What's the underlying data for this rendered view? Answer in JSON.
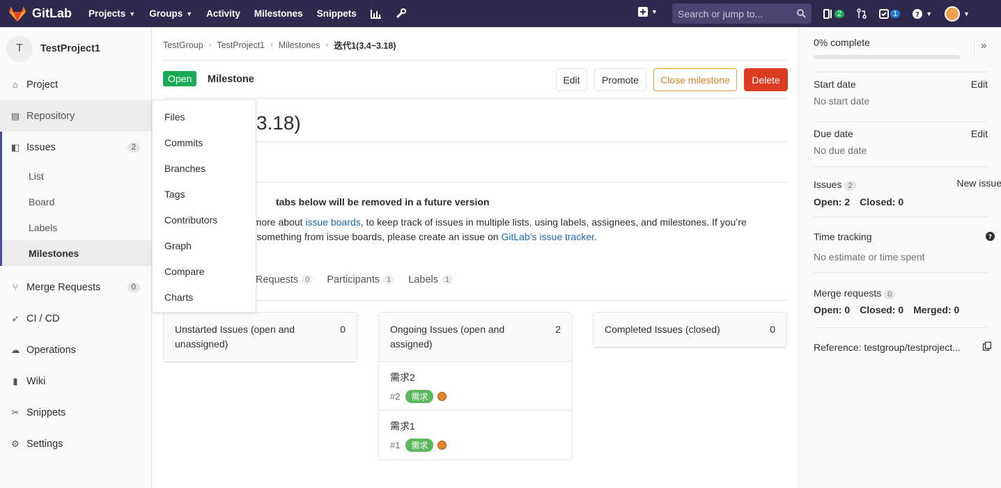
{
  "topnav": {
    "brand": "GitLab",
    "links": [
      "Projects",
      "Groups",
      "Activity",
      "Milestones",
      "Snippets"
    ],
    "search_placeholder": "Search or jump to...",
    "issues_count": "2",
    "todos_count": "1",
    "colors": {
      "bg": "#30294e",
      "search_bg": "#4b4470"
    }
  },
  "sidebar": {
    "project_initial": "T",
    "project_name": "TestProject1",
    "items": {
      "project": "Project",
      "repository": "Repository",
      "issues": "Issues",
      "issues_count": "2",
      "merge_requests": "Merge Requests",
      "mr_count": "0",
      "cicd": "CI / CD",
      "operations": "Operations",
      "wiki": "Wiki",
      "snippets": "Snippets",
      "settings": "Settings"
    },
    "issue_sub": [
      "List",
      "Board",
      "Labels",
      "Milestones"
    ]
  },
  "breadcrumb": [
    "TestGroup",
    "TestProject1",
    "Milestones",
    "迭代1(3.4~3.18)"
  ],
  "header": {
    "status": "Open",
    "label": "Milestone",
    "edit": "Edit",
    "promote": "Promote",
    "close": "Close milestone",
    "delete": "Delete"
  },
  "title_visible": "3.18)",
  "notice": {
    "title": "tabs below will be removed in a future version",
    "line1_pre": "n more about ",
    "line1_link": "issue boards",
    "line1_post": ", to keep track of issues in multiple lists, using labels, assignees, and milestones. If you’re",
    "line2_pre": "ng something from issue boards, please create an issue on ",
    "line2_link": "GitLab’s issue tracker",
    "line2_post": "."
  },
  "tabs": [
    {
      "label": "Requests",
      "count": "0"
    },
    {
      "label": "Participants",
      "count": "1"
    },
    {
      "label": "Labels",
      "count": "1"
    }
  ],
  "columns": {
    "unstarted": {
      "title": "Unstarted Issues (open and unassigned)",
      "count": "0"
    },
    "ongoing": {
      "title": "Ongoing Issues (open and assigned)",
      "count": "2"
    },
    "completed": {
      "title": "Completed Issues (closed)",
      "count": "0"
    }
  },
  "ongoing_issues": [
    {
      "title": "需求2",
      "ref": "#2",
      "label": "需求"
    },
    {
      "title": "需求1",
      "ref": "#1",
      "label": "需求"
    }
  ],
  "repo_dropdown": [
    "Files",
    "Commits",
    "Branches",
    "Tags",
    "Contributors",
    "Graph",
    "Compare",
    "Charts"
  ],
  "right_sidebar": {
    "progress_text": "0% complete",
    "progress_value": 0,
    "start_label": "Start date",
    "start_value": "No start date",
    "due_label": "Due date",
    "due_value": "No due date",
    "edit": "Edit",
    "issues_label": "Issues",
    "issues_count": "2",
    "new_issue": "New issue",
    "issues_open": "Open: 2",
    "issues_closed": "Closed: 0",
    "time_label": "Time tracking",
    "time_value": "No estimate or time spent",
    "mr_label": "Merge requests",
    "mr_count": "0",
    "mr_open": "Open: 0",
    "mr_closed": "Closed: 0",
    "mr_merged": "Merged: 0",
    "reference": "Reference: testgroup/testproject..."
  }
}
